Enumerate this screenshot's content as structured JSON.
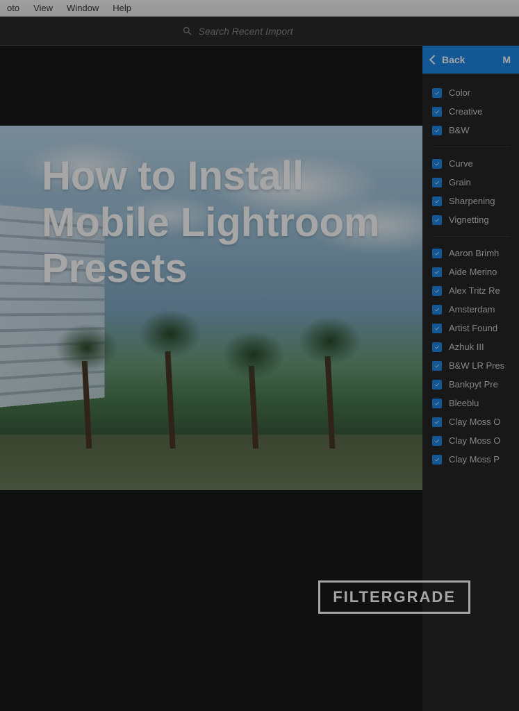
{
  "menubar": {
    "items": [
      "oto",
      "View",
      "Window",
      "Help"
    ]
  },
  "search": {
    "placeholder": "Search Recent Import"
  },
  "title_overlay": "How to Install Mobile Lightroom Presets",
  "sidebar": {
    "back_label": "Back",
    "right_label": "M",
    "group1": [
      {
        "label": "Color",
        "checked": true
      },
      {
        "label": "Creative",
        "checked": true
      },
      {
        "label": "B&W",
        "checked": true
      }
    ],
    "group2": [
      {
        "label": "Curve",
        "checked": true
      },
      {
        "label": "Grain",
        "checked": true
      },
      {
        "label": "Sharpening",
        "checked": true
      },
      {
        "label": "Vignetting",
        "checked": true
      }
    ],
    "group3": [
      {
        "label": "Aaron Brimh",
        "checked": true
      },
      {
        "label": "Aide Merino",
        "checked": true
      },
      {
        "label": "Alex Tritz Re",
        "checked": true
      },
      {
        "label": "Amsterdam",
        "checked": true
      },
      {
        "label": "Artist Found",
        "checked": true
      },
      {
        "label": "Azhuk III",
        "checked": true
      },
      {
        "label": "B&W LR Pres",
        "checked": true
      },
      {
        "label": "Bankpyt Pre",
        "checked": true
      },
      {
        "label": "Bleeblu",
        "checked": true
      },
      {
        "label": "Clay Moss O",
        "checked": true
      },
      {
        "label": "Clay Moss O",
        "checked": true
      },
      {
        "label": "Clay Moss P",
        "checked": true
      }
    ]
  },
  "logo": "FILTERGRADE"
}
